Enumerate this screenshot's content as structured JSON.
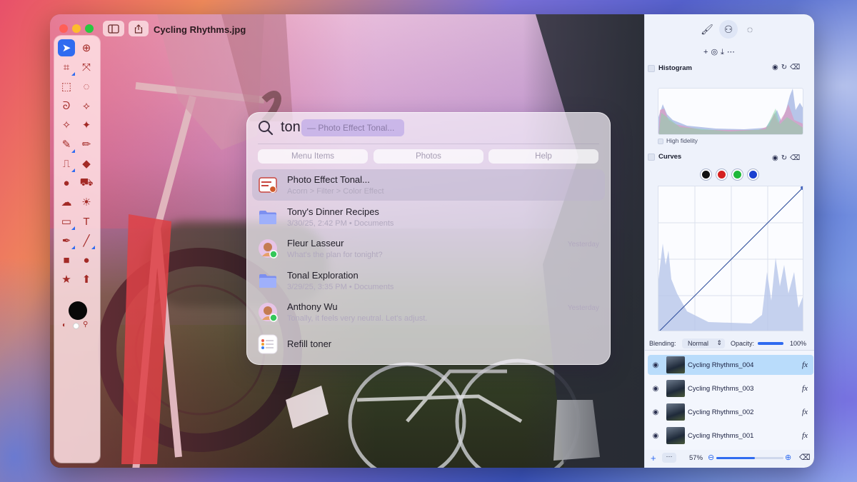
{
  "window": {
    "document_title": "Cycling Rhythms.jpg"
  },
  "toolbar": {
    "tools": [
      {
        "name": "move-tool",
        "icon": "arrow-cursor-icon",
        "selected": true
      },
      {
        "name": "zoom-tool",
        "icon": "magnifier-plus-icon"
      },
      {
        "name": "crop-tool",
        "icon": "crop-icon"
      },
      {
        "name": "transform-tool",
        "icon": "expand-arrows-icon"
      },
      {
        "name": "rect-select-tool",
        "icon": "dashed-rect-icon"
      },
      {
        "name": "ellipse-select-tool",
        "icon": "dashed-circle-icon"
      },
      {
        "name": "lasso-tool",
        "icon": "lasso-icon"
      },
      {
        "name": "poly-lasso-tool",
        "icon": "poly-lasso-icon"
      },
      {
        "name": "magic-wand-tool",
        "icon": "magic-wand-icon"
      },
      {
        "name": "magic-select-tool",
        "icon": "sparkle-wand-icon"
      },
      {
        "name": "brush-tool",
        "icon": "brush-icon"
      },
      {
        "name": "pencil-tool",
        "icon": "pencil-icon"
      },
      {
        "name": "clone-tool",
        "icon": "stamp-icon"
      },
      {
        "name": "eraser-tool",
        "icon": "eraser-icon"
      },
      {
        "name": "person-tool",
        "icon": "person-icon"
      },
      {
        "name": "paint-bucket-tool",
        "icon": "bucket-icon"
      },
      {
        "name": "dodge-tool",
        "icon": "cloud-sun-icon"
      },
      {
        "name": "sun-tool",
        "icon": "sun-icon"
      },
      {
        "name": "gradient-tool",
        "icon": "gradient-icon"
      },
      {
        "name": "text-tool",
        "icon": "text-t-icon"
      },
      {
        "name": "pen-tool",
        "icon": "pen-nib-icon"
      },
      {
        "name": "line-tool",
        "icon": "line-icon"
      },
      {
        "name": "rect-shape-tool",
        "icon": "filled-rect-icon"
      },
      {
        "name": "ellipse-shape-tool",
        "icon": "filled-circle-icon"
      },
      {
        "name": "star-shape-tool",
        "icon": "star-icon"
      },
      {
        "name": "arrow-shape-tool",
        "icon": "up-arrow-icon"
      }
    ],
    "foreground_color": "#080808",
    "background_color": "#ffffff"
  },
  "spotlight": {
    "query": "ton",
    "autocomplete": "— Photo Effect Tonal...",
    "scopes": [
      "Menu Items",
      "Photos",
      "Help"
    ],
    "results": [
      {
        "title": "Photo Effect Tonal...",
        "subtitle": "Acorn > Filter > Color Effect",
        "when": "",
        "icon": "filter-menu-icon",
        "selected": true
      },
      {
        "title": "Tony's Dinner Recipes",
        "subtitle": "3/30/25, 2:42 PM • Documents",
        "when": "",
        "icon": "folder-icon"
      },
      {
        "title": "Fleur Lasseur",
        "subtitle": "What's the plan for tonight?",
        "when": "Yesterday",
        "icon": "contact-avatar-icon"
      },
      {
        "title": "Tonal Exploration",
        "subtitle": "3/29/25, 3:35 PM • Documents",
        "when": "",
        "icon": "folder-icon"
      },
      {
        "title": "Anthony Wu",
        "subtitle": "Tonally, it feels very neutral. Let's adjust.",
        "when": "Yesterday",
        "icon": "contact-avatar-icon"
      },
      {
        "title": "Refill toner",
        "subtitle": "",
        "when": "",
        "icon": "reminders-icon"
      }
    ]
  },
  "panel": {
    "histogram": {
      "title": "Histogram",
      "option": "High fidelity"
    },
    "curves": {
      "title": "Curves",
      "channels": [
        "#111111",
        "#d42020",
        "#1fb83a",
        "#1a3fd0"
      ]
    },
    "blending": {
      "label": "Blending:",
      "mode": "Normal",
      "opacity_label": "Opacity:",
      "opacity_value": "100%",
      "opacity_fraction": 1.0
    },
    "layers": [
      {
        "name": "Cycling Rhythms_004",
        "selected": true
      },
      {
        "name": "Cycling Rhythms_003",
        "selected": false
      },
      {
        "name": "Cycling Rhythms_002",
        "selected": false
      },
      {
        "name": "Cycling Rhythms_001",
        "selected": false
      }
    ],
    "zoom": {
      "value": "57%",
      "fraction": 0.57
    },
    "fx_label": "fx",
    "accent": "#2f6bf0"
  }
}
